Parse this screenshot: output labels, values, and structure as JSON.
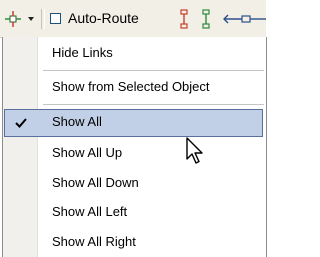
{
  "toolbar": {
    "links_icon": "link-mode-icon",
    "dropdown_icon": "chevron-down-icon",
    "auto_route": {
      "label": "Auto-Route",
      "checked": false
    },
    "icons": [
      "vertical-link-icon",
      "vertical-link-alt-icon",
      "horizontal-link-icon"
    ]
  },
  "menu": {
    "items": [
      {
        "label": "Hide Links",
        "checked": false
      },
      {
        "label": "Show from Selected Object",
        "checked": false
      },
      {
        "label": "Show All",
        "checked": true,
        "highlighted": true
      },
      {
        "label": "Show All Up",
        "checked": false
      },
      {
        "label": "Show All Down",
        "checked": false
      },
      {
        "label": "Show All Left",
        "checked": false
      },
      {
        "label": "Show All Right",
        "checked": false
      }
    ]
  },
  "colors": {
    "toolbar_bg": "#f2efe6",
    "gutter_bg": "#f1f0ec",
    "highlight_bg": "#c2d0e7",
    "highlight_border": "#5a6f9c",
    "icon_red": "#c8402a",
    "icon_green": "#2f8a3b"
  },
  "cursor_icon": "mouse-pointer-icon"
}
